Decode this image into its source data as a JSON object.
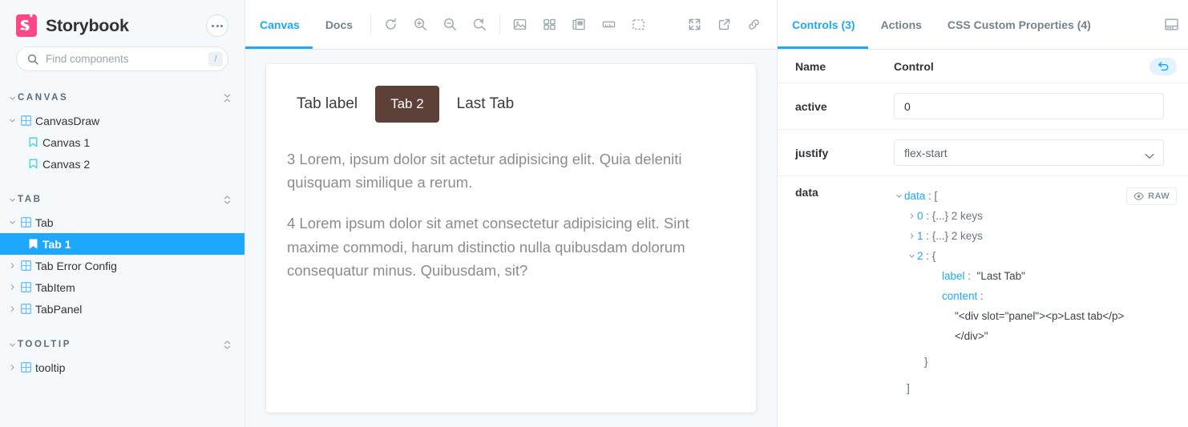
{
  "sidebar": {
    "brand": "Storybook",
    "menu_icon": "ellipsis-icon",
    "search": {
      "placeholder": "Find components",
      "value": "",
      "shortcut": "/"
    },
    "groups": [
      {
        "label": "CANVAS",
        "tool_icon": "collapse-all-icon",
        "items": [
          {
            "label": "CanvasDraw",
            "type": "component",
            "level": 1,
            "expanded": true,
            "selected": false
          },
          {
            "label": "Canvas 1",
            "type": "story",
            "level": 2,
            "selected": false
          },
          {
            "label": "Canvas 2",
            "type": "story",
            "level": 2,
            "selected": false
          }
        ]
      },
      {
        "label": "TAB",
        "tool_icon": "expand-all-icon",
        "items": [
          {
            "label": "Tab",
            "type": "component",
            "level": 1,
            "expanded": true,
            "selected": false
          },
          {
            "label": "Tab 1",
            "type": "story",
            "level": 2,
            "selected": true
          },
          {
            "label": "Tab Error Config",
            "type": "component",
            "level": 1,
            "expanded": false,
            "selected": false
          },
          {
            "label": "TabItem",
            "type": "component",
            "level": 1,
            "expanded": false,
            "selected": false
          },
          {
            "label": "TabPanel",
            "type": "component",
            "level": 1,
            "expanded": false,
            "selected": false
          }
        ]
      },
      {
        "label": "TOOLTIP",
        "tool_icon": "expand-all-icon",
        "items": [
          {
            "label": "tooltip",
            "type": "component",
            "level": 1,
            "expanded": false,
            "selected": false
          }
        ]
      }
    ]
  },
  "toolbar": {
    "tabs": [
      {
        "label": "Canvas",
        "active": true
      },
      {
        "label": "Docs",
        "active": false
      }
    ],
    "zoom_tools": [
      "reset-zoom-icon",
      "zoom-in-icon",
      "zoom-out-icon",
      "zoom-reset-icon"
    ],
    "addon_tools": [
      "background-icon",
      "grid-icon",
      "theme-icon",
      "measure-icon",
      "outline-icon"
    ],
    "right_tools": [
      "fullscreen-icon",
      "open-new-tab-icon",
      "copy-link-icon"
    ]
  },
  "preview": {
    "tabs": [
      {
        "label": "Tab label",
        "active": false
      },
      {
        "label": "Tab 2",
        "active": true
      },
      {
        "label": "Last Tab",
        "active": false
      }
    ],
    "active_color": "#5D4037",
    "paragraphs": [
      "3 Lorem, ipsum dolor sit actetur adipisicing elit. Quia deleniti quisquam similique a rerum.",
      "4 Lorem ipsum dolor sit amet consectetur adipisicing elit. Sint maxime commodi, harum distinctio nulla quibusdam dolorum consequatur minus. Quibusdam, sit?"
    ]
  },
  "panel": {
    "tabs": [
      {
        "label": "Controls (3)",
        "active": true
      },
      {
        "label": "Actions",
        "active": false
      },
      {
        "label": "CSS Custom Properties (4)",
        "active": false
      }
    ],
    "dock_icon": "panel-position-icon",
    "table": {
      "col_name": "Name",
      "col_control": "Control",
      "reset_icon": "undo-icon"
    },
    "controls": {
      "active": {
        "name": "active",
        "value": "0"
      },
      "justify": {
        "name": "justify",
        "value": "flex-start"
      },
      "data": {
        "name": "data",
        "raw_label": "RAW",
        "raw_icon": "eye-icon",
        "tree": {
          "root_key": "data",
          "open_bracket": "[",
          "close_bracket": "]",
          "items": [
            {
              "index": "0",
              "summary": "{...} 2 keys",
              "expanded": false
            },
            {
              "index": "1",
              "summary": "{...} 2 keys",
              "expanded": false
            },
            {
              "index": "2",
              "summary": "{",
              "expanded": true,
              "fields": [
                {
                  "key": "label",
                  "value": "\"Last Tab\""
                },
                {
                  "key": "content",
                  "value": "\"<div slot=\"panel\"><p>Last tab</p>",
                  "value_line2": "</div>\""
                }
              ],
              "close": "}"
            }
          ]
        }
      }
    }
  },
  "colors": {
    "accent": "#1EA7FD",
    "brand": "#FF4785",
    "preview_active_tab": "#5D4037"
  }
}
